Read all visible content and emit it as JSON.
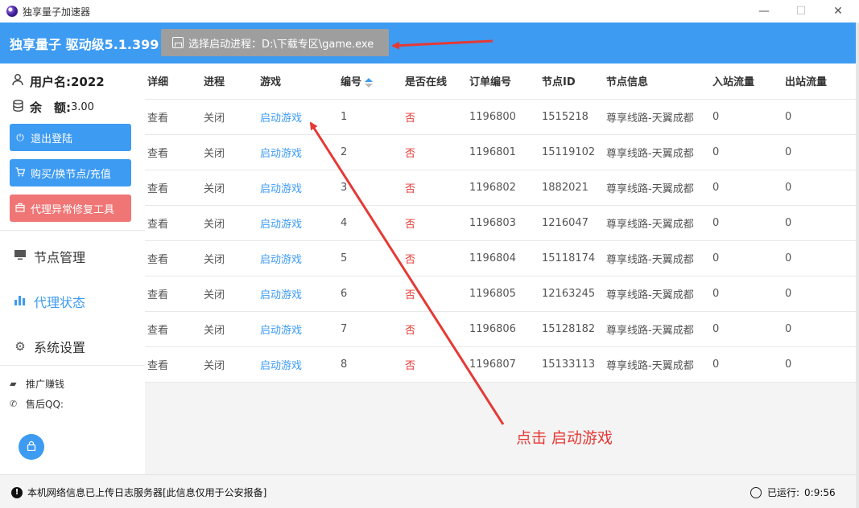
{
  "window": {
    "title": "独享量子加速器",
    "min_glyph": "—",
    "max_glyph": "☐",
    "close_glyph": "✕"
  },
  "header": {
    "brand": "独享量子 驱动级5.1.399",
    "process_button": "选择启动进程：D:\\下载专区\\game.exe",
    "color": "#3d9bf2"
  },
  "sidebar": {
    "username_label": "用户名:2022",
    "balance_label": "余　额:",
    "balance_value": "3.00",
    "buttons": {
      "logout": "退出登陆",
      "buy": "购买/换节点/充值",
      "repair": "代理异常修复工具"
    },
    "nav": {
      "nodes": "节点管理",
      "proxy_status": "代理状态",
      "settings": "系统设置"
    },
    "promo": "推广赚钱",
    "support_qq": "售后QQ:"
  },
  "table": {
    "columns": [
      "详细",
      "进程",
      "游戏",
      "编号",
      "是否在线",
      "订单编号",
      "节点ID",
      "节点信息",
      "入站流量",
      "出站流量"
    ],
    "rows": [
      {
        "detail": "查看",
        "process": "关闭",
        "game": "启动游戏",
        "num": "1",
        "online": "否",
        "order": "1196800",
        "node_id": "1515218",
        "node_info": "尊享线路-天翼成都",
        "in": "0",
        "out": "0"
      },
      {
        "detail": "查看",
        "process": "关闭",
        "game": "启动游戏",
        "num": "2",
        "online": "否",
        "order": "1196801",
        "node_id": "15119102",
        "node_info": "尊享线路-天翼成都",
        "in": "0",
        "out": "0"
      },
      {
        "detail": "查看",
        "process": "关闭",
        "game": "启动游戏",
        "num": "3",
        "online": "否",
        "order": "1196802",
        "node_id": "1882021",
        "node_info": "尊享线路-天翼成都",
        "in": "0",
        "out": "0"
      },
      {
        "detail": "查看",
        "process": "关闭",
        "game": "启动游戏",
        "num": "4",
        "online": "否",
        "order": "1196803",
        "node_id": "1216047",
        "node_info": "尊享线路-天翼成都",
        "in": "0",
        "out": "0"
      },
      {
        "detail": "查看",
        "process": "关闭",
        "game": "启动游戏",
        "num": "5",
        "online": "否",
        "order": "1196804",
        "node_id": "15118174",
        "node_info": "尊享线路-天翼成都",
        "in": "0",
        "out": "0"
      },
      {
        "detail": "查看",
        "process": "关闭",
        "game": "启动游戏",
        "num": "6",
        "online": "否",
        "order": "1196805",
        "node_id": "12163245",
        "node_info": "尊享线路-天翼成都",
        "in": "0",
        "out": "0"
      },
      {
        "detail": "查看",
        "process": "关闭",
        "game": "启动游戏",
        "num": "7",
        "online": "否",
        "order": "1196806",
        "node_id": "15128182",
        "node_info": "尊享线路-天翼成都",
        "in": "0",
        "out": "0"
      },
      {
        "detail": "查看",
        "process": "关闭",
        "game": "启动游戏",
        "num": "8",
        "online": "否",
        "order": "1196807",
        "node_id": "15133113",
        "node_info": "尊享线路-天翼成都",
        "in": "0",
        "out": "0"
      }
    ]
  },
  "annotation": {
    "text": "点击  启动游戏",
    "color": "#e53935"
  },
  "status": {
    "info_icon": "!",
    "message": "本机网络信息已上传日志服务器[此信息仅用于公安报备]",
    "runtime_label": "已运行:",
    "runtime_value": "0:9:56"
  },
  "icons": {
    "user": "user-icon",
    "balance": "database-icon",
    "logout": "power-icon",
    "buy": "cart-icon",
    "repair": "toolbox-icon",
    "nodes": "monitor-icon",
    "proxy": "bar-chart-icon",
    "settings": "gear-icon",
    "promo": "ticket-icon",
    "support": "phone-icon",
    "lock": "lock-icon",
    "timer": "stopwatch-icon"
  }
}
